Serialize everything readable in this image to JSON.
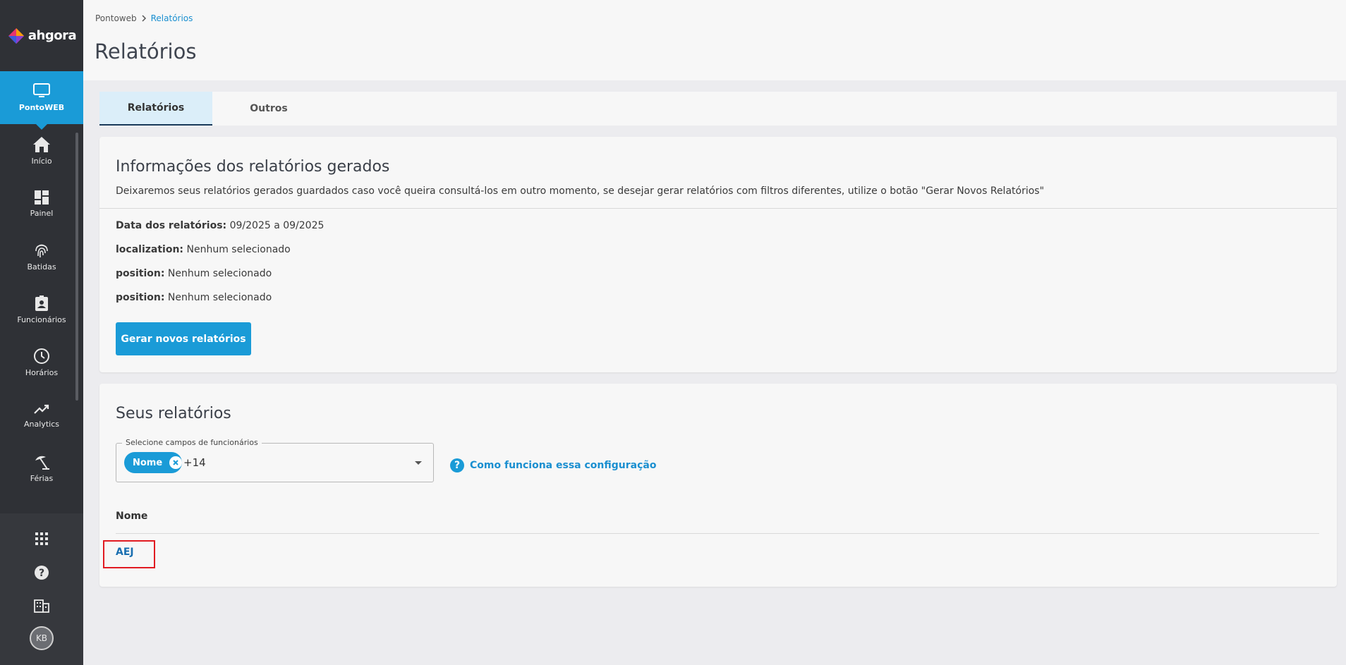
{
  "sidebar": {
    "logo_text": "ahgora",
    "module_label": "PontoWEB",
    "items": [
      {
        "label": "Início",
        "icon": "home-icon"
      },
      {
        "label": "Painel",
        "icon": "dashboard-icon"
      },
      {
        "label": "Batidas",
        "icon": "fingerprint-icon"
      },
      {
        "label": "Funcionários",
        "icon": "badge-icon"
      },
      {
        "label": "Horários",
        "icon": "clock-icon"
      },
      {
        "label": "Analytics",
        "icon": "trending-up-icon"
      },
      {
        "label": "Férias",
        "icon": "beach-umbrella-icon"
      }
    ],
    "avatar_initials": "KB"
  },
  "breadcrumb": {
    "root": "Pontoweb",
    "current": "Relatórios"
  },
  "page_title": "Relatórios",
  "tabs": [
    {
      "label": "Relatórios",
      "active": true
    },
    {
      "label": "Outros",
      "active": false
    }
  ],
  "info_card": {
    "title": "Informações dos relatórios gerados",
    "description": "Deixaremos seus relatórios gerados guardados caso você queira consultá-los em outro momento, se desejar gerar relatórios com filtros diferentes, utilize o botão \"Gerar Novos Relatórios\"",
    "fields": [
      {
        "label": "Data dos relatórios:",
        "value": "09/2025 a 09/2025"
      },
      {
        "label": "localization:",
        "value": "Nenhum selecionado"
      },
      {
        "label": "position:",
        "value": "Nenhum selecionado"
      },
      {
        "label": "position:",
        "value": "Nenhum selecionado"
      }
    ],
    "button_label": "Gerar novos relatórios"
  },
  "reports_card": {
    "title": "Seus relatórios",
    "select_legend": "Selecione campos de funcionários",
    "chip_label": "Nome",
    "more_count": "+14",
    "help_link": "Como funciona essa configuração",
    "column_header": "Nome",
    "rows": [
      "AEJ"
    ]
  },
  "colors": {
    "primary": "#1a9bd7",
    "sidebar_bg": "#2f3136",
    "highlight": "#e11b22"
  }
}
